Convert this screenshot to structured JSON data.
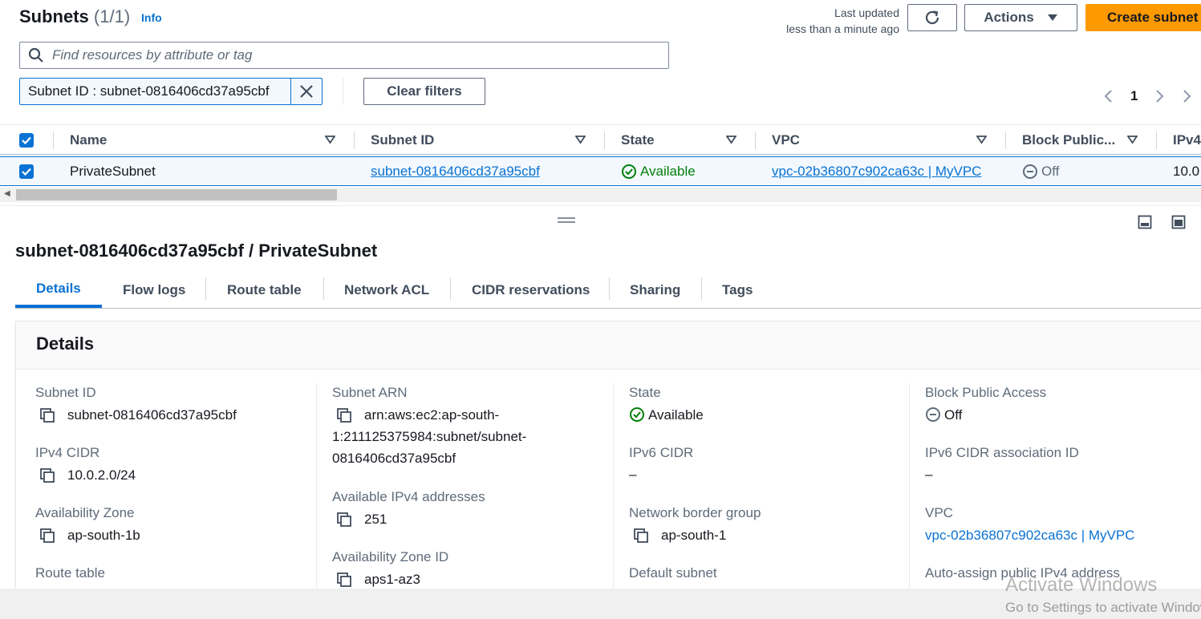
{
  "header": {
    "title": "Subnets",
    "count": "(1/1)",
    "info_label": "Info",
    "last_updated_line1": "Last updated",
    "last_updated_line2": "less than a minute ago",
    "actions_label": "Actions",
    "create_label": "Create subnet"
  },
  "search": {
    "placeholder": "Find resources by attribute or tag"
  },
  "filter": {
    "token": "Subnet ID : subnet-0816406cd37a95cbf",
    "clear_label": "Clear filters"
  },
  "pagination": {
    "current_page": "1"
  },
  "table": {
    "columns": [
      "Name",
      "Subnet ID",
      "State",
      "VPC",
      "Block Public...",
      "IPv4"
    ],
    "rows": [
      {
        "selected": true,
        "name": "PrivateSubnet",
        "subnet_id": "subnet-0816406cd37a95cbf",
        "state": "Available",
        "vpc": "vpc-02b36807c902ca63c | MyVPC",
        "block_public": "Off",
        "ipv4": "10.0"
      }
    ]
  },
  "detail": {
    "title": "subnet-0816406cd37a95cbf / PrivateSubnet",
    "tabs": [
      "Details",
      "Flow logs",
      "Route table",
      "Network ACL",
      "CIDR reservations",
      "Sharing",
      "Tags"
    ],
    "active_tab": "Details",
    "section_title": "Details",
    "fields": {
      "subnet_id_label": "Subnet ID",
      "subnet_id": "subnet-0816406cd37a95cbf",
      "ipv4_cidr_label": "IPv4 CIDR",
      "ipv4_cidr": "10.0.2.0/24",
      "az_label": "Availability Zone",
      "az": "ap-south-1b",
      "route_table_label": "Route table",
      "subnet_arn_label": "Subnet ARN",
      "subnet_arn_line1": "arn:aws:ec2:ap-south-",
      "subnet_arn_line2": "1:211125375984:subnet/subnet-",
      "subnet_arn_line3": "0816406cd37a95cbf",
      "avail_ipv4_label": "Available IPv4 addresses",
      "avail_ipv4": "251",
      "az_id_label": "Availability Zone ID",
      "az_id": "aps1-az3",
      "state_label": "State",
      "state": "Available",
      "ipv6_cidr_label": "IPv6 CIDR",
      "ipv6_cidr": "–",
      "nbg_label": "Network border group",
      "nbg": "ap-south-1",
      "default_subnet_label": "Default subnet",
      "bpa_label": "Block Public Access",
      "bpa": "Off",
      "ipv6_assoc_label": "IPv6 CIDR association ID",
      "ipv6_assoc": "–",
      "vpc_label": "VPC",
      "vpc": "vpc-02b36807c902ca63c | MyVPC",
      "auto_assign_label": "Auto-assign public IPv4 address"
    }
  },
  "watermark": {
    "line1": "Activate Windows",
    "line2": "Go to Settings to activate Windows."
  },
  "colors": {
    "accent": "#0972d3",
    "primary_button": "#ff9900",
    "success": "#037f0c",
    "muted": "#5f6b7a"
  }
}
